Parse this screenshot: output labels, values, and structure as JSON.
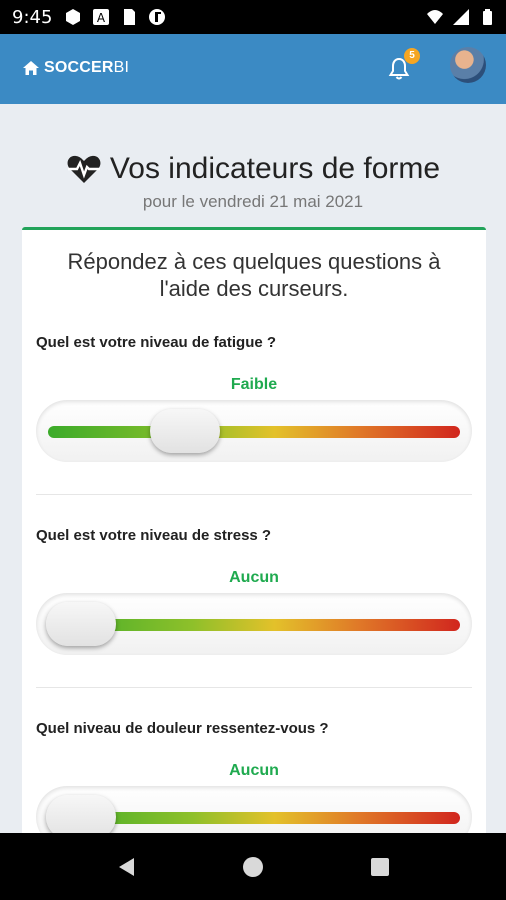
{
  "status_bar": {
    "time": "9:45",
    "icons": [
      "hexagon-icon",
      "font-icon",
      "sim-icon",
      "circle-f-icon"
    ],
    "right_icons": [
      "wifi-icon",
      "signal-icon",
      "battery-icon"
    ]
  },
  "app_bar": {
    "brand_bold": "SOCCER",
    "brand_light": "BI",
    "notification_count": "5"
  },
  "header": {
    "title": "Vos indicateurs de forme",
    "subtitle": "pour le vendredi 21 mai 2021"
  },
  "card": {
    "intro_line1": "Répondez à ces quelques questions à",
    "intro_line2": "l'aide des curseurs.",
    "questions": [
      {
        "label": "Quel est votre niveau de fatigue ?",
        "value_text": "Faible",
        "level": 0.3
      },
      {
        "label": "Quel est votre niveau de stress ?",
        "value_text": "Aucun",
        "level": 0.0
      },
      {
        "label": "Quel niveau de douleur ressentez-vous ?",
        "value_text": "Aucun",
        "level": 0.0
      }
    ]
  },
  "colors": {
    "app_bar": "#3b8ac4",
    "accent_green": "#22a35a",
    "value_green": "#1faa4f",
    "badge": "#f5a623"
  }
}
